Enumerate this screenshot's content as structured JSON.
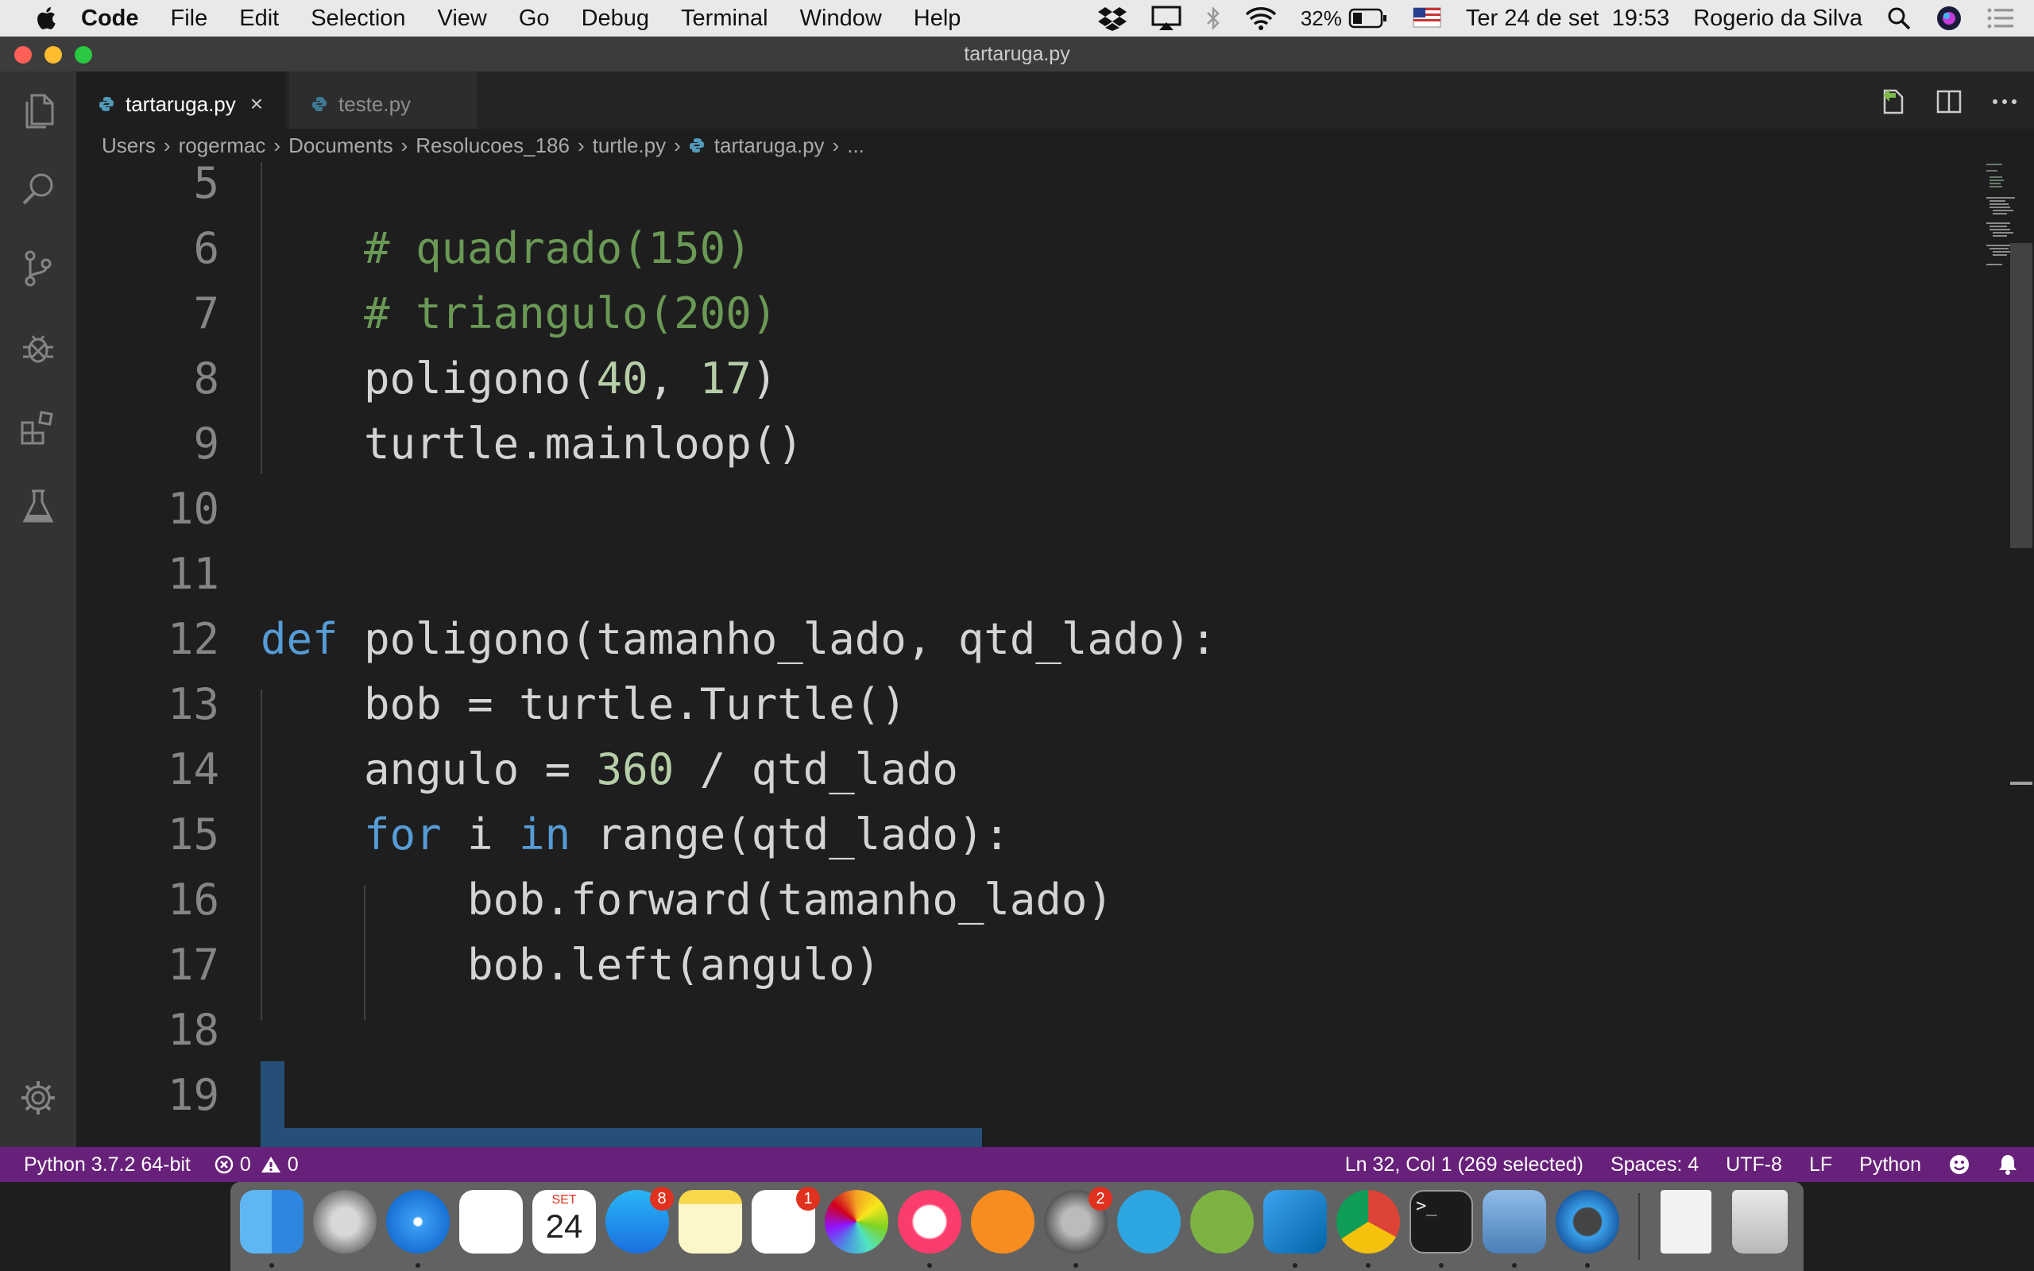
{
  "menubar": {
    "app_name": "Code",
    "items": [
      "File",
      "Edit",
      "Selection",
      "View",
      "Go",
      "Debug",
      "Terminal",
      "Window",
      "Help"
    ],
    "battery": "32%",
    "datetime": "Ter 24 de set  19:53",
    "user": "Rogerio da Silva"
  },
  "window": {
    "title": "tartaruga.py"
  },
  "tabs": [
    {
      "label": "tartaruga.py",
      "active": true
    },
    {
      "label": "teste.py",
      "active": false
    }
  ],
  "breadcrumb": [
    "Users",
    "rogermac",
    "Documents",
    "Resolucoes_186",
    "turtle.py",
    "tartaruga.py",
    "..."
  ],
  "editor": {
    "language": "python",
    "lines": [
      {
        "n": "5",
        "text": ""
      },
      {
        "n": "6",
        "text": "    # quadrado(150)"
      },
      {
        "n": "7",
        "text": "    # triangulo(200)"
      },
      {
        "n": "8",
        "text": "    poligono(40, 17)"
      },
      {
        "n": "9",
        "text": "    turtle.mainloop()"
      },
      {
        "n": "10",
        "text": ""
      },
      {
        "n": "11",
        "text": ""
      },
      {
        "n": "12",
        "text": "def poligono(tamanho_lado, qtd_lado):"
      },
      {
        "n": "13",
        "text": "    bob = turtle.Turtle()"
      },
      {
        "n": "14",
        "text": "    angulo = 360 / qtd_lado"
      },
      {
        "n": "15",
        "text": "    for i in range(qtd_lado):"
      },
      {
        "n": "16",
        "text": "        bob.forward(tamanho_lado)"
      },
      {
        "n": "17",
        "text": "        bob.left(angulo)"
      },
      {
        "n": "18",
        "text": ""
      },
      {
        "n": "19",
        "text": ""
      }
    ]
  },
  "statusbar": {
    "interpreter": "Python 3.7.2 64-bit",
    "errors": "0",
    "warnings": "0",
    "cursor": "Ln 32, Col 1 (269 selected)",
    "indent": "Spaces: 4",
    "encoding": "UTF-8",
    "eol": "LF",
    "language": "Python"
  },
  "dock": {
    "calendar_month": "SET",
    "calendar_day": "24",
    "app_store_badge": "8",
    "reminders_badge": "1",
    "system_prefs_badge": "2"
  },
  "colors": {
    "statusbar": "#68217a",
    "editor_bg": "#1e1e1e",
    "keyword": "#569cd6",
    "comment": "#6a9955",
    "number": "#b5cea8"
  }
}
